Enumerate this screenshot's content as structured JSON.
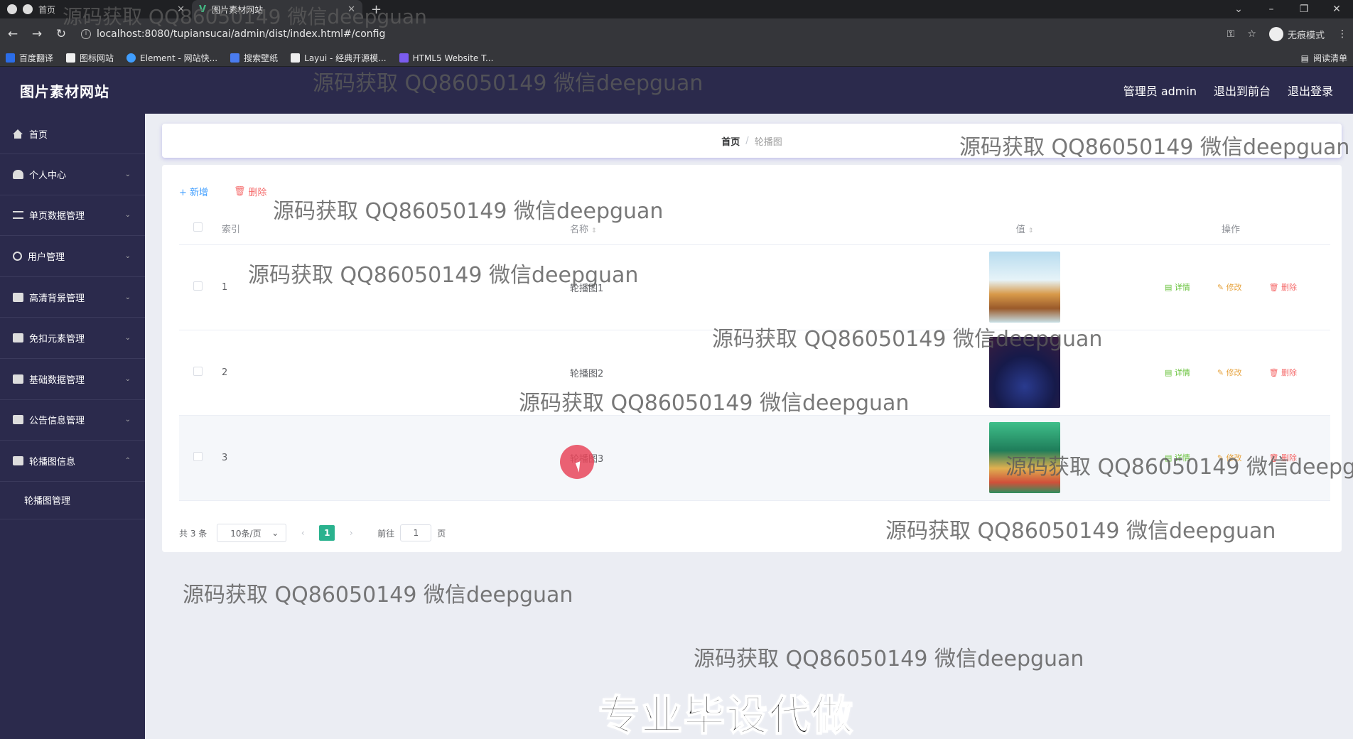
{
  "browser": {
    "tabs": [
      {
        "label": "首页"
      },
      {
        "label": "图片素材网站"
      }
    ],
    "url": "localhost:8080/tupiansucai/admin/dist/index.html#/config",
    "incognito_label": "无痕模式",
    "bookmarks": [
      {
        "label": "百度翻译",
        "color": "#2b6de8"
      },
      {
        "label": "图标网站",
        "color": "#f0f0f0"
      },
      {
        "label": "Element - 网站快...",
        "color": "#409eff"
      },
      {
        "label": "搜索壁纸",
        "color": "#4a7cf0"
      },
      {
        "label": "Layui - 经典开源模...",
        "color": "#eee"
      },
      {
        "label": "HTML5 Website T...",
        "color": "#7b5cf0"
      }
    ],
    "reading_list": "阅读清单"
  },
  "header": {
    "title": "图片素材网站",
    "admin_label": "管理员 admin",
    "to_front": "退出到前台",
    "logout": "退出登录"
  },
  "sidebar": {
    "items": [
      {
        "label": "首页",
        "icon": "home-icon"
      },
      {
        "label": "个人中心",
        "icon": "user-icon"
      },
      {
        "label": "单页数据管理",
        "icon": "list-icon"
      },
      {
        "label": "用户管理",
        "icon": "clock-icon"
      },
      {
        "label": "高清背景管理",
        "icon": "box-icon"
      },
      {
        "label": "免扣元素管理",
        "icon": "box-icon"
      },
      {
        "label": "基础数据管理",
        "icon": "box-icon"
      },
      {
        "label": "公告信息管理",
        "icon": "box-icon"
      },
      {
        "label": "轮播图信息",
        "icon": "box-icon"
      }
    ],
    "submenu": "轮播图管理"
  },
  "breadcrumb": {
    "home": "首页",
    "sep": "/",
    "current": "轮播图"
  },
  "toolbar": {
    "add": "+ 新增",
    "delete": "删除"
  },
  "table": {
    "headers": {
      "index": "索引",
      "name": "名称",
      "value": "值",
      "ops": "操作"
    },
    "rows": [
      {
        "index": "1",
        "name": "轮播图1"
      },
      {
        "index": "2",
        "name": "轮播图2"
      },
      {
        "index": "3",
        "name": "轮播图3"
      }
    ],
    "op_detail": "详情",
    "op_edit": "修改",
    "op_delete": "删除"
  },
  "pager": {
    "total": "共 3 条",
    "page_size": "10条/页",
    "current_page": "1",
    "goto_label": "前往",
    "goto_value": "1",
    "page_unit": "页"
  },
  "watermark": "源码获取 QQ86050149 微信deepguan",
  "banner": "专业毕设代做"
}
